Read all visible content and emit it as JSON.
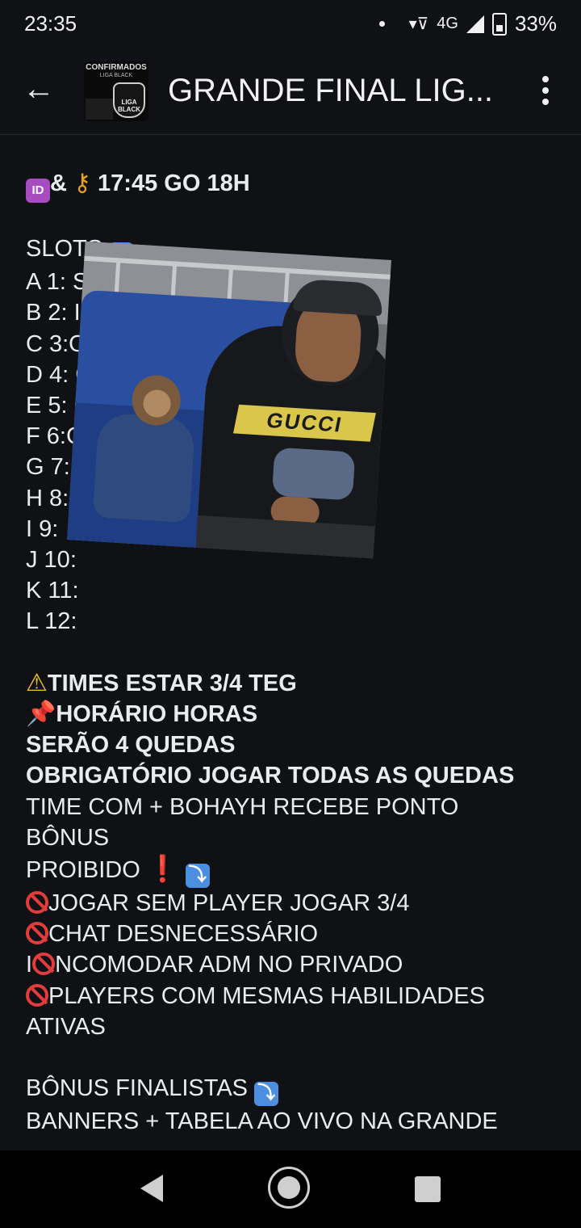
{
  "status_bar": {
    "time": "23:35",
    "network": "4G",
    "battery": "33%",
    "icons": [
      "notification-dot-icon",
      "wifi-icon",
      "signal-icon",
      "battery-icon"
    ]
  },
  "header": {
    "title": "GRANDE FINAL LIG...",
    "avatar_text": "CONFIRMADOS",
    "avatar_sub": "LIGA BLACK",
    "avatar_badge": "LIGA BLACK"
  },
  "message": {
    "line_id": "& ",
    "line_id_tail": " 17:45 GO 18H",
    "slots_label": "SLOTS ",
    "slots": [
      "A 1: S",
      "B 2: IN",
      "C 3:O",
      "D 4: G",
      "E 5: G",
      "F 6:C",
      "G 7:",
      "H 8:",
      "I 9:",
      "J 10:",
      "K 11:",
      "L 12:"
    ],
    "warn_line": "TIMES ESTAR 3/4 TEG",
    "pin_line": "HORÁRIO HORAS",
    "bold_1": "SERÃO 4 QUEDAS",
    "bold_2": "OBRIGATÓRIO JOGAR TODAS AS QUEDAS",
    "bonus_1": "TIME COM + BOHAYH RECEBE PONTO",
    "bonus_2": "BÔNUS",
    "proibido": "PROIBIDO ",
    "rule_1": "JOGAR SEM PLAYER JOGAR 3/4",
    "rule_2": "CHAT DESNECESSÁRIO",
    "rule_3_pre": "I",
    "rule_3_post": "NCOMODAR ADM NO PRIVADO",
    "rule_4": "PLAYERS COM MESMAS HABILIDADES",
    "rule_4b": "ATIVAS",
    "finalistas": "BÔNUS FINALISTAS ",
    "last_line": "BANNERS + TABELA AO VIVO NA GRANDE"
  },
  "sticker": {
    "shirt_text": "GUCCI"
  },
  "colors": {
    "background": "#0f1114",
    "text": "#e9ecef",
    "id_badge": "#a74bc0",
    "arrow_badge": "#4c8fe0",
    "prohibited": "#e23c3c"
  }
}
